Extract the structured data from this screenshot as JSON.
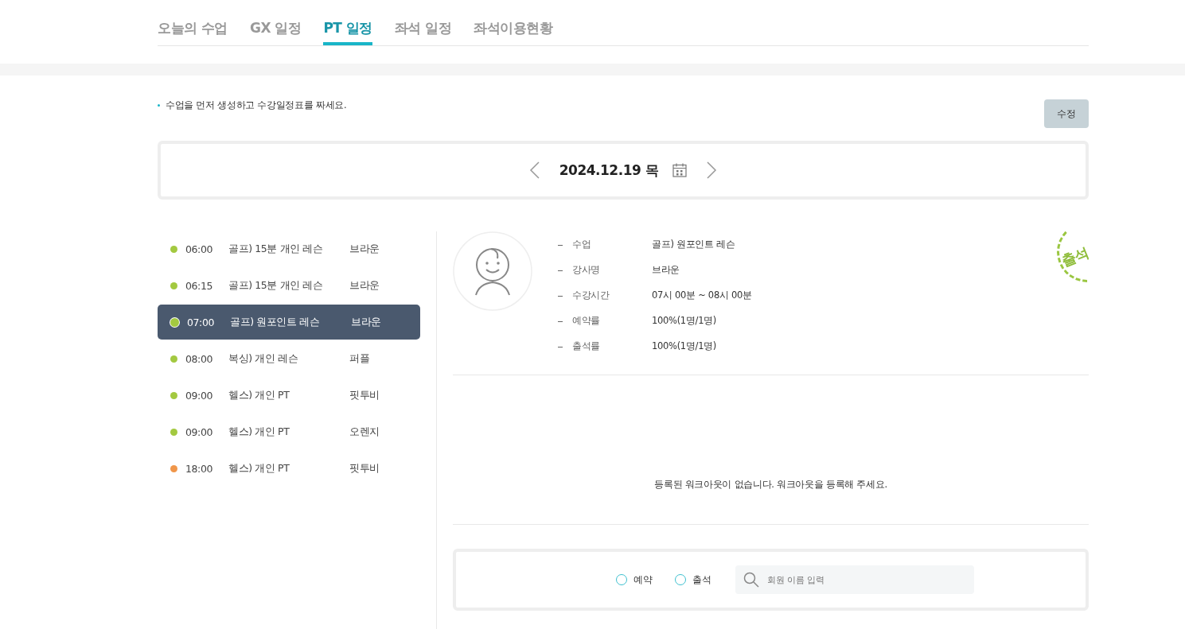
{
  "tabs": [
    {
      "label": "오늘의 수업",
      "selected": false
    },
    {
      "label": "GX 일정",
      "selected": false
    },
    {
      "label": "PT 일정",
      "selected": true
    },
    {
      "label": "좌석 일정",
      "selected": false
    },
    {
      "label": "좌석이용현황",
      "selected": false
    }
  ],
  "notice": "수업을 먼저 생성하고 수강일정표를 짜세요.",
  "edit_button": "수정",
  "date": "2024.12.19 목",
  "schedule": [
    {
      "time": "06:00",
      "class": "골프) 15분 개인 레슨",
      "instructor": "브라운",
      "color": "#a3c940",
      "selected": false
    },
    {
      "time": "06:15",
      "class": "골프) 15분 개인 레슨",
      "instructor": "브라운",
      "color": "#a3c940",
      "selected": false
    },
    {
      "time": "07:00",
      "class": "골프) 원포인트 레슨",
      "instructor": "브라운",
      "color": "#a3c940",
      "selected": true
    },
    {
      "time": "08:00",
      "class": "복싱) 개인 레슨",
      "instructor": "퍼플",
      "color": "#a3c940",
      "selected": false
    },
    {
      "time": "09:00",
      "class": "헬스) 개인 PT",
      "instructor": "핏투비",
      "color": "#a3c940",
      "selected": false
    },
    {
      "time": "09:00",
      "class": "헬스) 개인 PT",
      "instructor": "오렌지",
      "color": "#a3c940",
      "selected": false
    },
    {
      "time": "18:00",
      "class": "헬스) 개인 PT",
      "instructor": "핏투비",
      "color": "#f0964a",
      "selected": false
    }
  ],
  "details": [
    {
      "label": "수업",
      "value": "골프) 원포인트 레슨"
    },
    {
      "label": "강사명",
      "value": "브라운"
    },
    {
      "label": "수강시간",
      "value": "07시 00분 ~ 08시 00분"
    },
    {
      "label": "예약률",
      "value": "100%(1명/1명)"
    },
    {
      "label": "출석률",
      "value": "100%(1명/1명)"
    }
  ],
  "stamp": "출석",
  "empty_message": "등록된 워크아웃이 없습니다. 워크아웃을 등록해 주세요.",
  "filters": [
    {
      "label": "예약",
      "selected": false
    },
    {
      "label": "출석",
      "selected": false
    }
  ],
  "search": {
    "placeholder": "회원 이름 입력"
  }
}
